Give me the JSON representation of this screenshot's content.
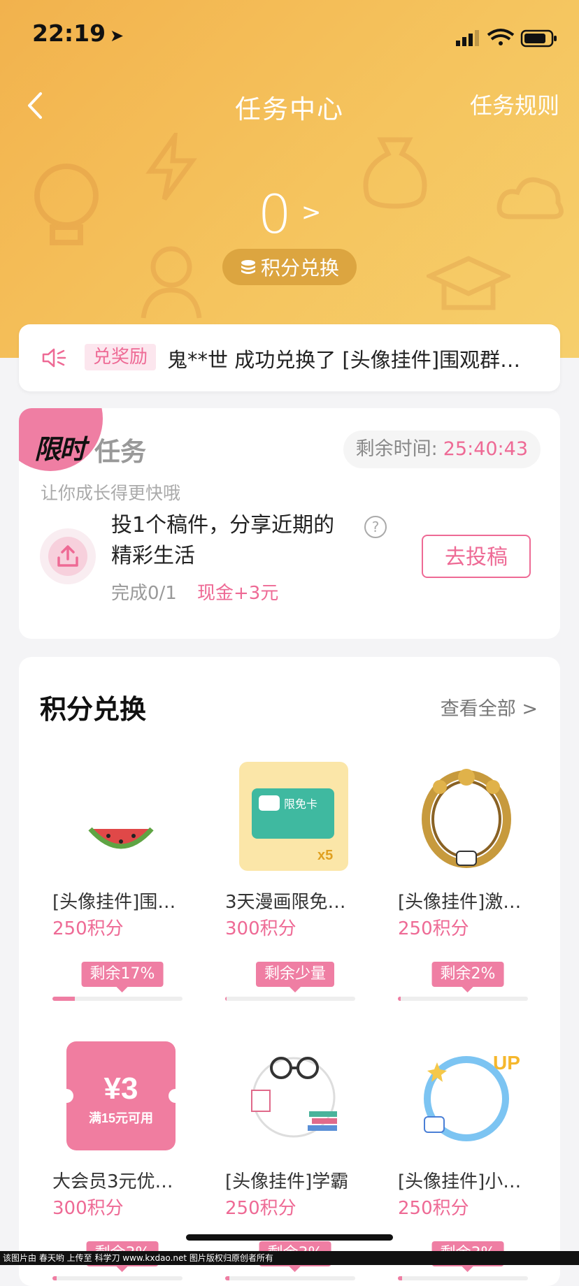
{
  "status_bar": {
    "time": "22:19"
  },
  "nav": {
    "title": "任务中心",
    "rules": "任务规则"
  },
  "points": {
    "value": "0",
    "exchange_label": "积分兑换"
  },
  "ticker": {
    "tag": "兑奖励",
    "message": "鬼**世 成功兑换了 [头像挂件]围观群…"
  },
  "task_card": {
    "badge_text": "限时",
    "title": "任务",
    "remaining_label": "剩余时间:",
    "countdown": "25:40:43",
    "subtitle": "让你成长得更快哦",
    "task_name": "投1个稿件，分享近期的精彩生活",
    "progress": "完成0/1",
    "reward": "现金+3元",
    "button": "去投稿"
  },
  "shop": {
    "title": "积分兑换",
    "view_all": "查看全部",
    "items": [
      {
        "name": "[头像挂件]围…",
        "price": "250积分",
        "stock": "剩余17%",
        "fill": 0.17,
        "icon": "watermelon-icon"
      },
      {
        "name": "3天漫画限免…",
        "price": "300积分",
        "stock": "剩余少量",
        "fill": 0.01,
        "icon": "comic-card-icon"
      },
      {
        "name": "[头像挂件]激…",
        "price": "250积分",
        "stock": "剩余2%",
        "fill": 0.02,
        "icon": "gold-frame-icon"
      },
      {
        "name": "大会员3元优…",
        "price": "300积分",
        "stock": "剩余3%",
        "fill": 0.03,
        "icon": "coupon-icon"
      },
      {
        "name": "[头像挂件]学霸",
        "price": "250积分",
        "stock": "剩余3%",
        "fill": 0.03,
        "icon": "scholar-frame-icon"
      },
      {
        "name": "[头像挂件]小…",
        "price": "250积分",
        "stock": "剩余3%",
        "fill": 0.03,
        "icon": "blue-frame-icon"
      }
    ]
  },
  "coupon": {
    "amount": "¥3",
    "condition": "满15元可用"
  },
  "comic_card": {
    "label": "限免卡",
    "count": "x5"
  },
  "footer": "该图片由 春天哟 上传至 科学刀 www.kxdao.net 图片版权归原创者所有"
}
